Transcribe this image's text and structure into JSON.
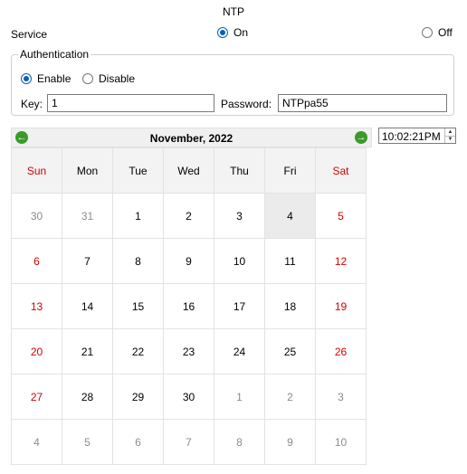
{
  "title": "NTP",
  "service": {
    "label": "Service",
    "on_label": "On",
    "off_label": "Off",
    "selected": "On"
  },
  "auth": {
    "legend": "Authentication",
    "enable_label": "Enable",
    "disable_label": "Disable",
    "selected": "Enable",
    "key_label": "Key:",
    "key_value": "1",
    "password_label": "Password:",
    "password_value": "NTPpa55"
  },
  "time": {
    "value": "10:02:21PM"
  },
  "calendar": {
    "month_year": "November, 2022",
    "prev_icon": "left-arrow-icon",
    "next_icon": "right-arrow-icon",
    "weekdays": [
      "Sun",
      "Mon",
      "Tue",
      "Wed",
      "Thu",
      "Fri",
      "Sat"
    ],
    "weeks": [
      [
        "30",
        "31",
        "1",
        "2",
        "3",
        "4",
        "5"
      ],
      [
        "6",
        "7",
        "8",
        "9",
        "10",
        "11",
        "12"
      ],
      [
        "13",
        "14",
        "15",
        "16",
        "17",
        "18",
        "19"
      ],
      [
        "20",
        "21",
        "22",
        "23",
        "24",
        "25",
        "26"
      ],
      [
        "27",
        "28",
        "29",
        "30",
        "1",
        "2",
        "3"
      ],
      [
        "4",
        "5",
        "6",
        "7",
        "8",
        "9",
        "10"
      ]
    ],
    "selected_day": "4",
    "colors": {
      "weekend": "#d40000",
      "dim": "#8c8c8c",
      "nav": "#3a9a2a",
      "radio": "#0a5fb4"
    }
  }
}
